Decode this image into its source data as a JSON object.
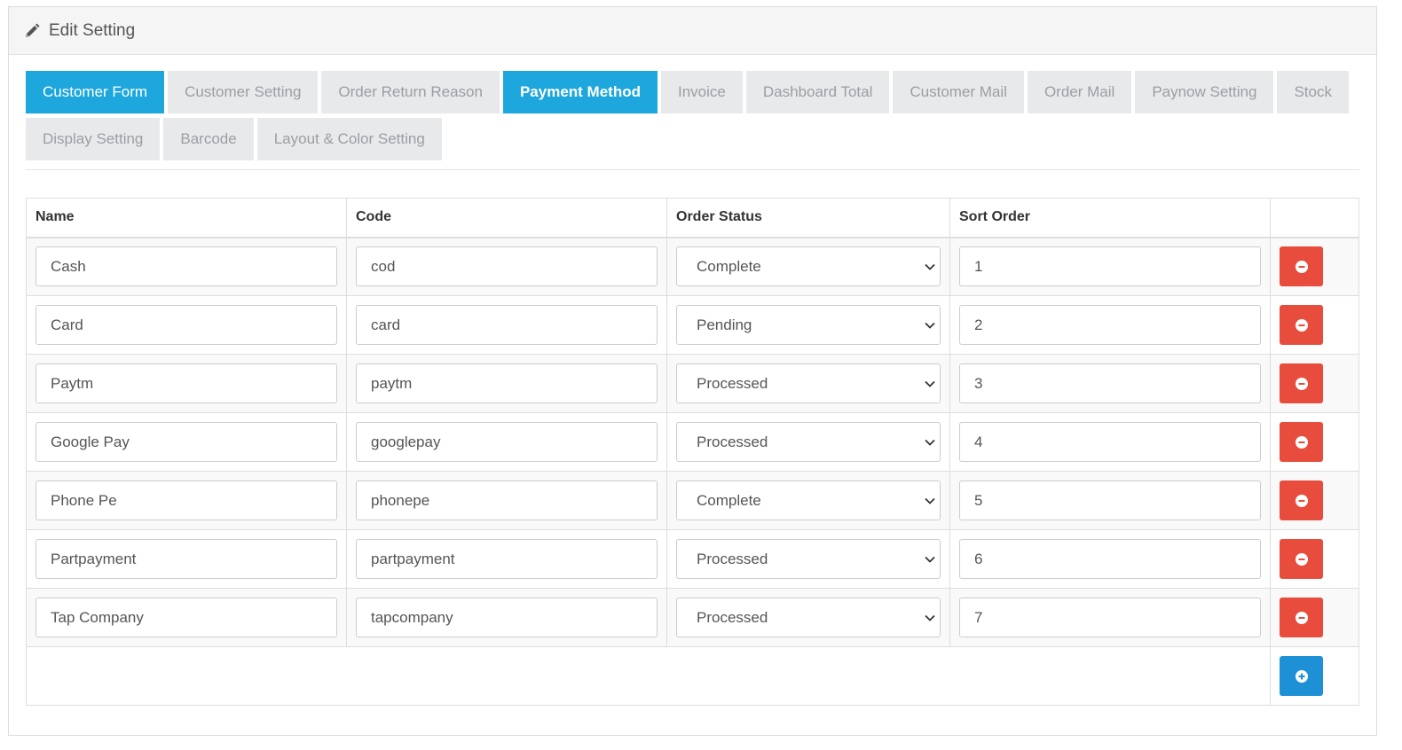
{
  "header": {
    "title": "Edit Setting",
    "icon": "pencil-icon"
  },
  "tabs": [
    {
      "label": "Customer Form",
      "active": true,
      "bold": false
    },
    {
      "label": "Customer Setting",
      "active": false,
      "bold": false
    },
    {
      "label": "Order Return Reason",
      "active": false,
      "bold": false
    },
    {
      "label": "Payment Method",
      "active": true,
      "bold": true
    },
    {
      "label": "Invoice",
      "active": false,
      "bold": false
    },
    {
      "label": "Dashboard Total",
      "active": false,
      "bold": false
    },
    {
      "label": "Customer Mail",
      "active": false,
      "bold": false
    },
    {
      "label": "Order Mail",
      "active": false,
      "bold": false
    },
    {
      "label": "Paynow Setting",
      "active": false,
      "bold": false
    },
    {
      "label": "Stock",
      "active": false,
      "bold": false
    },
    {
      "label": "Display Setting",
      "active": false,
      "bold": false
    },
    {
      "label": "Barcode",
      "active": false,
      "bold": false
    },
    {
      "label": "Layout & Color Setting",
      "active": false,
      "bold": false
    }
  ],
  "table": {
    "headers": {
      "name": "Name",
      "code": "Code",
      "status": "Order Status",
      "sort": "Sort Order"
    },
    "rows": [
      {
        "name": "Cash",
        "code": "cod",
        "status": "Complete",
        "sort": "1"
      },
      {
        "name": "Card",
        "code": "card",
        "status": "Pending",
        "sort": "2"
      },
      {
        "name": "Paytm",
        "code": "paytm",
        "status": "Processed",
        "sort": "3"
      },
      {
        "name": "Google Pay",
        "code": "googlepay",
        "status": "Processed",
        "sort": "4"
      },
      {
        "name": "Phone Pe",
        "code": "phonepe",
        "status": "Complete",
        "sort": "5"
      },
      {
        "name": "Partpayment",
        "code": "partpayment",
        "status": "Processed",
        "sort": "6"
      },
      {
        "name": "Tap Company",
        "code": "tapcompany",
        "status": "Processed",
        "sort": "7"
      }
    ]
  },
  "icons": {
    "remove": "minus-circle-icon",
    "add": "plus-circle-icon",
    "dropdown": "chevron-down-icon"
  },
  "colors": {
    "tab_active": "#1ea7dd",
    "danger": "#e74c3c",
    "primary": "#1e91d6"
  }
}
